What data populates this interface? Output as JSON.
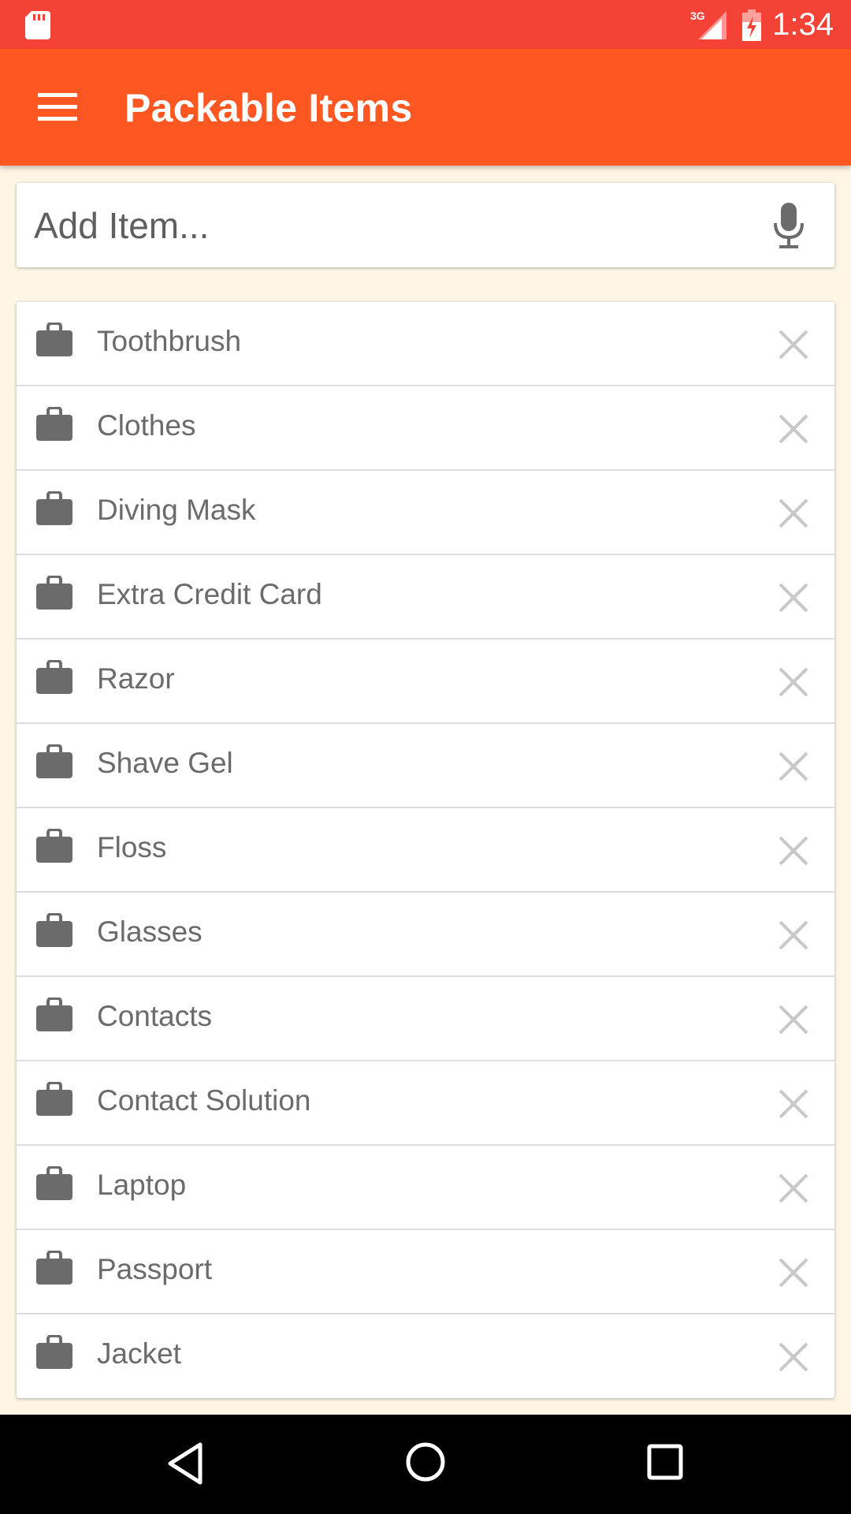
{
  "status_bar": {
    "network": "3G",
    "time": "1:34"
  },
  "app_bar": {
    "title": "Packable Items",
    "menu_icon": "hamburger-menu-icon"
  },
  "add_item": {
    "placeholder": "Add Item...",
    "value": "",
    "icon": "microphone-icon"
  },
  "items": [
    {
      "label": "Toothbrush",
      "icon": "briefcase-icon"
    },
    {
      "label": "Clothes",
      "icon": "briefcase-icon"
    },
    {
      "label": "Diving Mask",
      "icon": "briefcase-icon"
    },
    {
      "label": "Extra Credit Card",
      "icon": "briefcase-icon"
    },
    {
      "label": "Razor",
      "icon": "briefcase-icon"
    },
    {
      "label": "Shave Gel",
      "icon": "briefcase-icon"
    },
    {
      "label": "Floss",
      "icon": "briefcase-icon"
    },
    {
      "label": "Glasses",
      "icon": "briefcase-icon"
    },
    {
      "label": "Contacts",
      "icon": "briefcase-icon"
    },
    {
      "label": "Contact Solution",
      "icon": "briefcase-icon"
    },
    {
      "label": "Laptop",
      "icon": "briefcase-icon"
    },
    {
      "label": "Passport",
      "icon": "briefcase-icon"
    },
    {
      "label": "Jacket",
      "icon": "briefcase-icon"
    }
  ],
  "colors": {
    "status_bar": "#F44336",
    "app_bar": "#FF5722",
    "background": "#FDF6E6",
    "icon_gray": "#6b6b6b",
    "delete_gray": "#C8C8C8"
  }
}
